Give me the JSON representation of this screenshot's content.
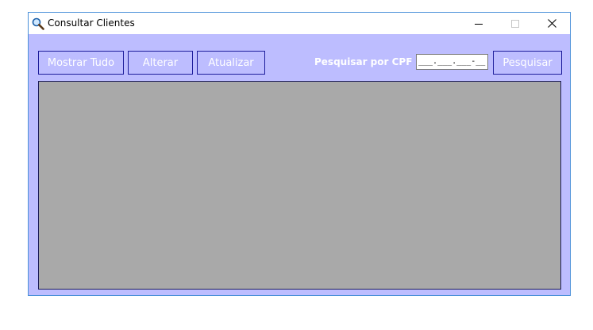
{
  "window": {
    "title": "Consultar Clientes",
    "icon": "search-icon"
  },
  "toolbar": {
    "mostrar_label": "Mostrar Tudo",
    "alterar_label": "Alterar",
    "atualizar_label": "Atualizar",
    "cpf_label": "Pesquisar por CPF",
    "cpf_mask": "___.___.___-__",
    "pesquisar_label": "Pesquisar"
  },
  "colors": {
    "client_background": "#bdbdff",
    "grid_background": "#a9a9a9",
    "button_border": "#1e1e9c",
    "text_light": "#ffffff"
  }
}
